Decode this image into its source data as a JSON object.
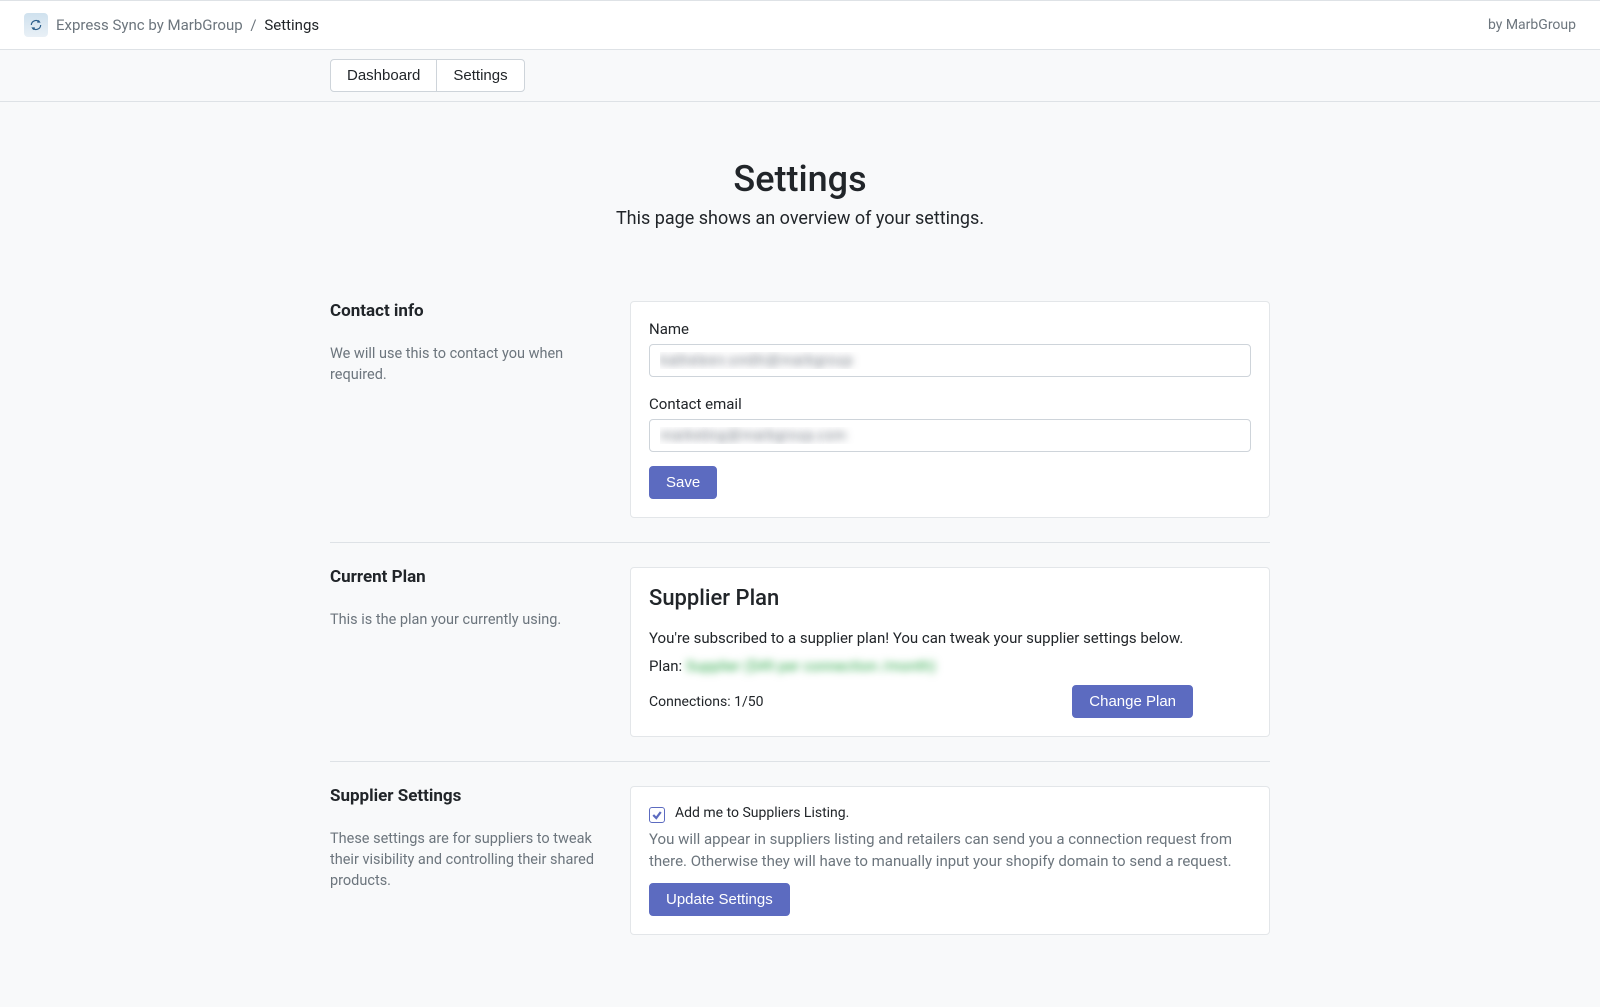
{
  "breadcrumb": {
    "app_name": "Express Sync by MarbGroup",
    "current": "Settings"
  },
  "header_right": "by MarbGroup",
  "tabs": {
    "dashboard": "Dashboard",
    "settings": "Settings"
  },
  "page": {
    "title": "Settings",
    "subtitle": "This page shows an overview of your settings."
  },
  "contact_info": {
    "heading": "Contact info",
    "desc": "We will use this to contact you when required.",
    "name_label": "Name",
    "name_value": "katheleen.smith@marbgroup",
    "email_label": "Contact email",
    "email_value": "marketing@marbgroup.com",
    "save": "Save"
  },
  "current_plan": {
    "heading": "Current Plan",
    "desc": "This is the plan your currently using.",
    "title": "Supplier Plan",
    "blurb": "You're subscribed to a supplier plan! You can tweak your supplier settings below.",
    "plan_label": "Plan:",
    "plan_value": "Supplier ($49 per connection /month)",
    "connections": "Connections: 1/50",
    "change_btn": "Change Plan"
  },
  "supplier_settings": {
    "heading": "Supplier Settings",
    "desc": "These settings are for suppliers to tweak their visibility and controlling their shared products.",
    "checkbox_label": "Add me to Suppliers Listing.",
    "helper": "You will appear in suppliers listing and retailers can send you a connection request from there. Otherwise they will have to manually input your shopify domain to send a request.",
    "update_btn": "Update Settings"
  }
}
